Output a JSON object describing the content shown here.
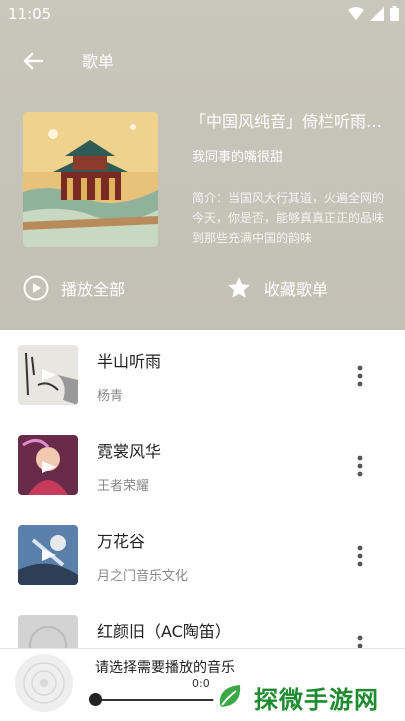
{
  "status_bar": {
    "time": "11:05"
  },
  "toolbar": {
    "title": "歌单"
  },
  "playlist": {
    "title": "「中国风纯音」倚栏听雨，思索红尘",
    "author": "我同事的嘴很甜",
    "description": "简介：当国风大行其道，火遍全网的今天，你是否，能够真真正正的品味到那些充满中国的韵味"
  },
  "actions": {
    "play_all": "播放全部",
    "collect": "收藏歌单"
  },
  "songs": [
    {
      "title": "半山听雨",
      "artist": "杨青"
    },
    {
      "title": "霓裳风华",
      "artist": "王者荣耀"
    },
    {
      "title": "万花谷",
      "artist": "月之门音乐文化"
    },
    {
      "title": "红颜旧（AC陶笛）",
      "artist": ""
    }
  ],
  "player": {
    "prompt": "请选择需要播放的音乐",
    "time": "0:0"
  },
  "watermark": {
    "text": "探微手游网"
  },
  "colors": {
    "header_bg": "#c6c3b8",
    "watermark": "#1e8c2e"
  }
}
